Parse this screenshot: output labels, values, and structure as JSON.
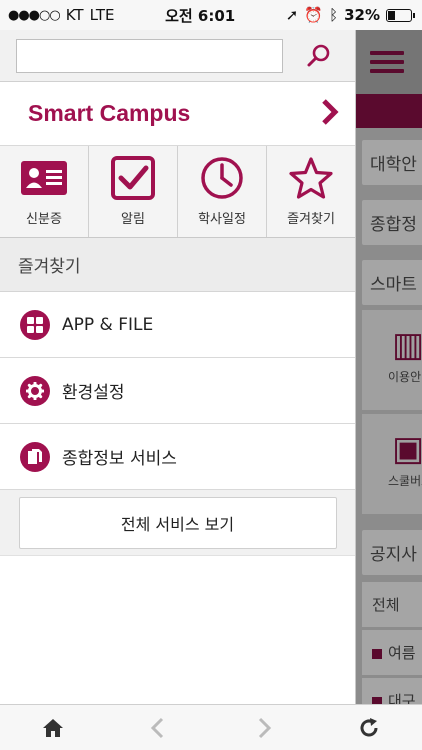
{
  "status_bar": {
    "carrier": "KT",
    "network": "LTE",
    "time": "오전 6:01",
    "battery": "32%",
    "battery_level": 0.32
  },
  "drawer": {
    "search": {
      "value": "",
      "placeholder": ""
    },
    "campus_title": "Smart Campus",
    "quick_items": [
      {
        "label": "신분증",
        "icon": "id-card-icon"
      },
      {
        "label": "알림",
        "icon": "checkbox-icon"
      },
      {
        "label": "학사일정",
        "icon": "clock-icon"
      },
      {
        "label": "즐겨찾기",
        "icon": "star-icon"
      }
    ],
    "favorites_header": "즐겨찾기",
    "menu_items": [
      {
        "label": "APP & FILE",
        "icon": "grid-icon"
      },
      {
        "label": "환경설정",
        "icon": "gear-icon"
      },
      {
        "label": "종합정보 서비스",
        "icon": "document-icon"
      }
    ],
    "all_services_label": "전체 서비스 보기"
  },
  "background_panel": {
    "row1": "대학안",
    "row2": "종합정",
    "row3": "스마트",
    "card1_label": "이용안",
    "card2_label": "스쿨버스",
    "row4": "공지사",
    "list_header": "전체",
    "list_item1": "여름",
    "list_item2": "대구"
  },
  "colors": {
    "accent": "#a0114f",
    "dark_accent": "#5a0a2e"
  }
}
